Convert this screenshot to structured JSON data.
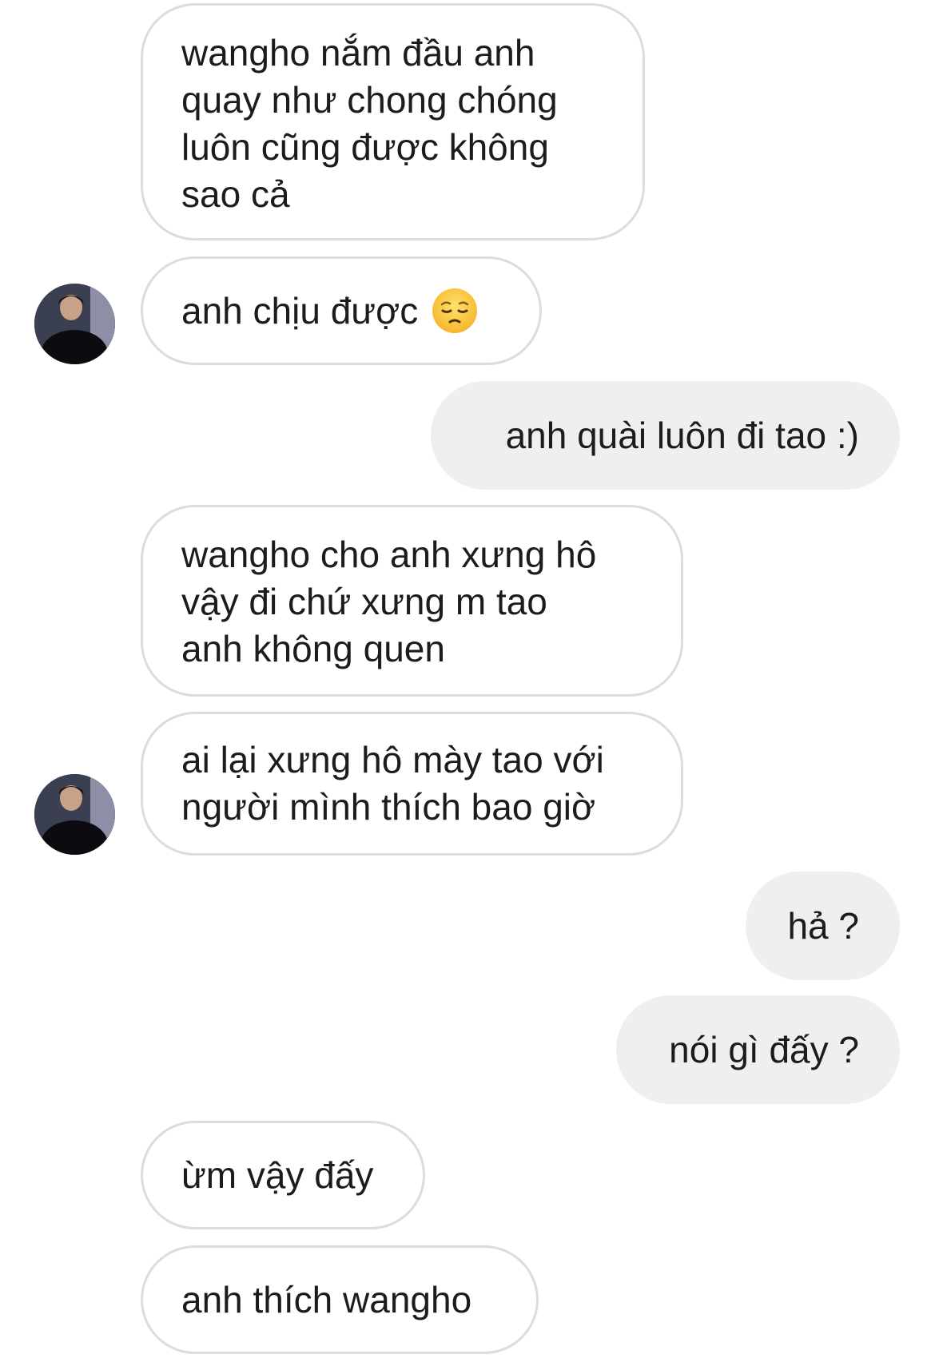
{
  "conversation": {
    "messages": [
      {
        "sender": "other",
        "text": "wangho nắm đầu anh\nquay như chong chóng\nluôn cũng được không\nsao cả"
      },
      {
        "sender": "other",
        "text": "anh chịu được",
        "emoji": "pensive-face-emoji"
      },
      {
        "sender": "me",
        "text": "anh quài luôn đi tao :)"
      },
      {
        "sender": "other",
        "text": "wangho cho anh xưng hô\nvậy đi chứ xưng m tao\nanh không quen"
      },
      {
        "sender": "other",
        "text": "ai lại xưng hô mày tao với\nngười mình thích bao giờ"
      },
      {
        "sender": "me",
        "text": "hả ?"
      },
      {
        "sender": "me",
        "text": "nói gì đấy ?"
      },
      {
        "sender": "other",
        "text": "ừm vậy đấy"
      },
      {
        "sender": "other",
        "text": "anh thích wangho"
      }
    ]
  },
  "colors": {
    "incoming_border": "#dcdcdc",
    "outgoing_background": "#efefef",
    "text": "#1c1c1e"
  }
}
